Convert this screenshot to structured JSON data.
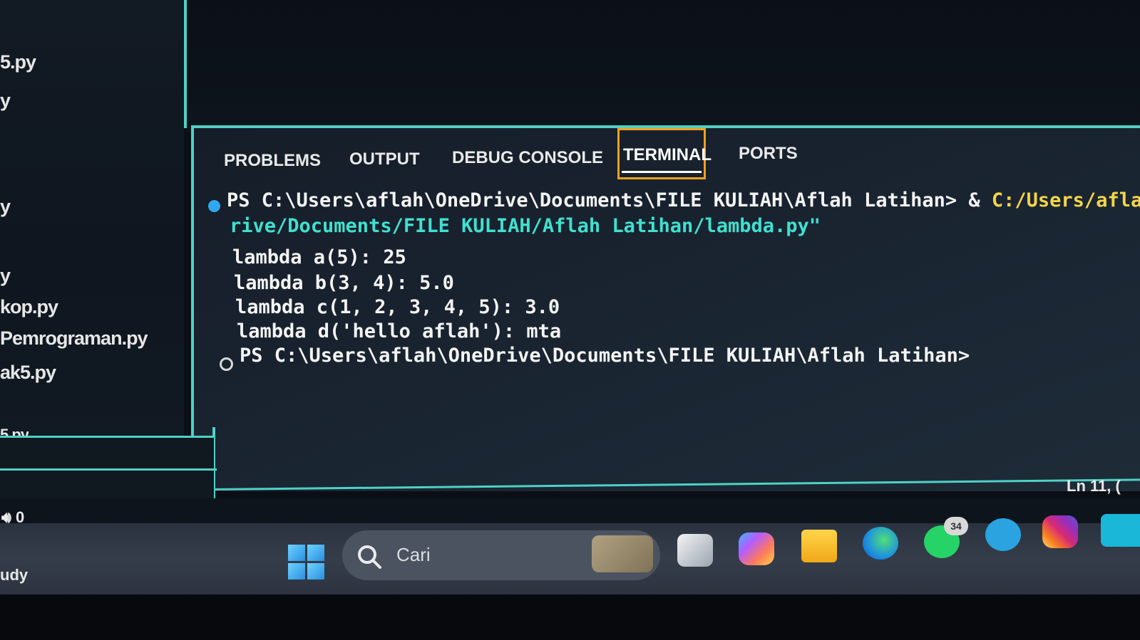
{
  "sidebar": {
    "files": [
      {
        "label": "5.py"
      },
      {
        "label": "y"
      },
      {
        "label": "y"
      },
      {
        "label": "y"
      },
      {
        "label": "kop.py"
      },
      {
        "label": "Pemrograman.py"
      },
      {
        "label": "ak5.py"
      },
      {
        "label": "5.py"
      }
    ]
  },
  "panel": {
    "tabs": [
      {
        "label": "PROBLEMS"
      },
      {
        "label": "OUTPUT"
      },
      {
        "label": "DEBUG CONSOLE"
      },
      {
        "label": "TERMINAL"
      },
      {
        "label": "PORTS"
      }
    ],
    "active_tab": "TERMINAL"
  },
  "terminal": {
    "prompt1": "PS C:\\Users\\aflah\\OneDrive\\Documents\\FILE KULIAH\\Aflah Latihan>",
    "cmd_amp": "&",
    "cmd_path": "C:/Users/aflah/App",
    "cmd_cont": "rive/Documents/FILE KULIAH/Aflah Latihan/lambda.py\"",
    "output": [
      "lambda a(5): 25",
      "lambda b(3, 4): 5.0",
      "lambda c(1, 2, 3, 4, 5): 3.0",
      "lambda d('hello aflah'): mta"
    ],
    "prompt2": "PS C:\\Users\\aflah\\OneDrive\\Documents\\FILE KULIAH\\Aflah Latihan>"
  },
  "status": {
    "position": "Ln 11, (",
    "count_left": "0"
  },
  "taskbar": {
    "left_text": "udy",
    "search_placeholder": "Cari",
    "whatsapp_badge": "34"
  },
  "colors": {
    "accent_teal": "#4fd1c5",
    "terminal_cyan": "#3fe0d0",
    "terminal_yellow": "#f5d547",
    "active_tab_border": "#f0a020",
    "success_dot": "#2ea8f0"
  }
}
